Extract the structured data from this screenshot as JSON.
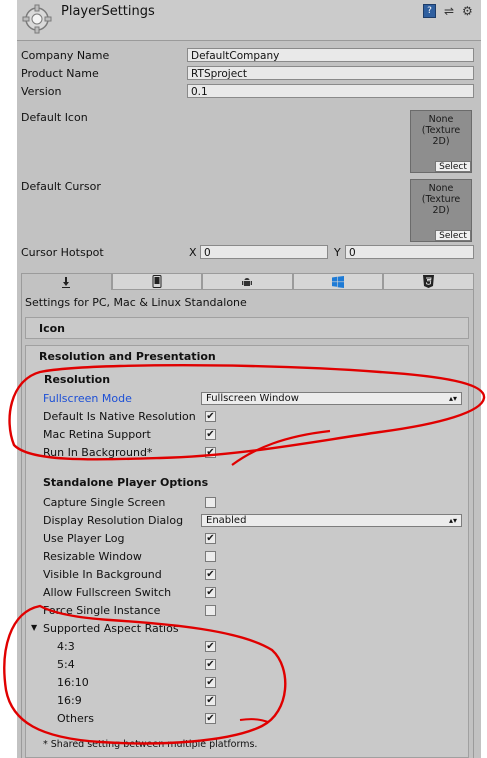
{
  "header": {
    "title": "PlayerSettings",
    "book_icon": "help-book-icon",
    "sliders_icon": "presets-sliders-icon",
    "gear_icon": "gear-icon"
  },
  "fields": {
    "company_name": {
      "label": "Company Name",
      "value": "DefaultCompany"
    },
    "product_name": {
      "label": "Product Name",
      "value": "RTSproject"
    },
    "version": {
      "label": "Version",
      "value": "0.1"
    },
    "default_icon": {
      "label": "Default Icon",
      "texture": "None\n(Texture\n2D)",
      "select": "Select"
    },
    "default_cursor": {
      "label": "Default Cursor",
      "texture": "None\n(Texture\n2D)",
      "select": "Select"
    },
    "cursor_hotspot": {
      "label": "Cursor Hotspot",
      "x_label": "X",
      "x_value": "0",
      "y_label": "Y",
      "y_value": "0"
    }
  },
  "platform_tabs": [
    "download-icon",
    "mobile-phone-icon",
    "android-icon",
    "windows-icon",
    "html5-icon"
  ],
  "settings_for": "Settings for PC, Mac & Linux Standalone",
  "sections": {
    "icon": "Icon",
    "resolution_presentation": "Resolution and Presentation",
    "resolution": "Resolution",
    "standalone": "Standalone Player Options"
  },
  "resolution_rows": [
    {
      "label": "Fullscreen Mode",
      "type": "dropdown",
      "value": "Fullscreen Window",
      "highlight": true
    },
    {
      "label": "Default Is Native Resolution",
      "checked": true
    },
    {
      "label": "Mac Retina Support",
      "checked": true
    },
    {
      "label": "Run In Background*",
      "checked": true
    }
  ],
  "standalone_rows": [
    {
      "label": "Capture Single Screen",
      "checked": false
    },
    {
      "label": "Display Resolution Dialog",
      "type": "dropdown",
      "value": "Enabled"
    },
    {
      "label": "Use Player Log",
      "checked": true
    },
    {
      "label": "Resizable Window",
      "checked": false
    },
    {
      "label": "Visible In Background",
      "checked": true
    },
    {
      "label": "Allow Fullscreen Switch",
      "checked": true
    },
    {
      "label": "Force Single Instance",
      "checked": false
    }
  ],
  "aspect_ratios": {
    "label": "Supported Aspect Ratios",
    "items": [
      {
        "label": "4:3",
        "checked": true
      },
      {
        "label": "5:4",
        "checked": true
      },
      {
        "label": "16:10",
        "checked": true
      },
      {
        "label": "16:9",
        "checked": true
      },
      {
        "label": "Others",
        "checked": true
      }
    ]
  },
  "footnote": "* Shared setting between multiple platforms.",
  "colors": {
    "annotation_red": "#e00000",
    "highlight_blue": "#1c4fd6",
    "panel": "#c2c2c2"
  }
}
